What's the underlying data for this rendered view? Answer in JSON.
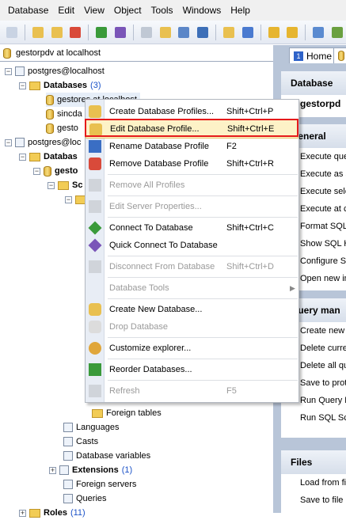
{
  "menubar": [
    "Database",
    "Edit",
    "View",
    "Object",
    "Tools",
    "Windows",
    "Help"
  ],
  "toolbar_icons": [
    "new-icon",
    "db-add-icon",
    "db-edit-icon",
    "db-remove-icon",
    "connect-icon",
    "quick-connect-icon",
    "disconnect-icon",
    "db-icon",
    "grid-icon",
    "options-icon",
    "db2-icon",
    "chart-icon",
    "sql-icon",
    "sql2-icon",
    "export-icon",
    "import-icon"
  ],
  "tree_header": "gestorpdv at localhost",
  "tree": [
    {
      "text": "postgres@localhost",
      "bold": false
    },
    {
      "text": "Databases",
      "count": "(3)",
      "bold": true
    },
    {
      "text": "gestores at localhost",
      "bold": false
    },
    {
      "text": "sincda",
      "bold": false
    },
    {
      "text": "gesto",
      "bold": false
    },
    {
      "text": "postgres@loc",
      "bold": false
    },
    {
      "text": "Databas",
      "bold": true
    },
    {
      "text": "gesto",
      "bold": true
    },
    {
      "text": "Sc",
      "bold": true
    },
    {
      "text": "Foreign tables",
      "bold": false
    },
    {
      "text": "Languages",
      "bold": false
    },
    {
      "text": "Casts",
      "bold": false
    },
    {
      "text": "Database variables",
      "bold": false
    },
    {
      "text": "Extensions",
      "count": "(1)",
      "bold": true
    },
    {
      "text": "Foreign servers",
      "bold": false
    },
    {
      "text": "Queries",
      "bold": false
    },
    {
      "text": "Roles",
      "count": "(11)",
      "bold": true
    }
  ],
  "tabs": {
    "home_num": "1",
    "home_label": "Home"
  },
  "right_panels": {
    "database_title": "Database",
    "database_value": "gestorpd",
    "general_title": "General",
    "general_items": [
      "Execute que",
      "Execute as s",
      "Execute sele",
      "Execute at c",
      "Format SQL",
      "Show SQL H",
      "Configure S",
      "Open new in"
    ],
    "query_title": "Query man",
    "query_items": [
      "Create new",
      "Delete curre",
      "Delete all qu",
      "Save to prot",
      "Run Query E",
      "Run SQL Scr"
    ],
    "files_title": "Files",
    "files_items": [
      "Load from fi",
      "Save to file"
    ]
  },
  "context_menu": [
    {
      "label": "Create Database Profiles...",
      "shortcut": "Shift+Ctrl+P",
      "disabled": false,
      "icon": "create-profile-icon"
    },
    {
      "label": "Edit Database Profile...",
      "shortcut": "Shift+Ctrl+E",
      "disabled": false,
      "icon": "edit-profile-icon",
      "highlight": true
    },
    {
      "label": "Rename Database Profile",
      "shortcut": "F2",
      "disabled": false,
      "icon": "rename-icon"
    },
    {
      "label": "Remove Database Profile",
      "shortcut": "Shift+Ctrl+R",
      "disabled": false,
      "icon": "remove-profile-icon"
    },
    {
      "label": "Remove All Profiles",
      "shortcut": "",
      "disabled": true,
      "icon": "remove-all-icon"
    },
    {
      "label": "Edit Server Properties...",
      "shortcut": "",
      "disabled": true,
      "icon": "server-properties-icon"
    },
    {
      "label": "Connect To Database",
      "shortcut": "Shift+Ctrl+C",
      "disabled": false,
      "icon": "connect-icon"
    },
    {
      "label": "Quick Connect To Database",
      "shortcut": "",
      "disabled": false,
      "icon": "quick-connect-icon"
    },
    {
      "label": "Disconnect From Database",
      "shortcut": "Shift+Ctrl+D",
      "disabled": true,
      "icon": "disconnect-icon"
    },
    {
      "label": "Database Tools",
      "shortcut": "",
      "disabled": true,
      "icon": "",
      "submenu": true
    },
    {
      "label": "Create New Database...",
      "shortcut": "",
      "disabled": false,
      "icon": "create-db-icon"
    },
    {
      "label": "Drop Database",
      "shortcut": "",
      "disabled": true,
      "icon": "drop-db-icon"
    },
    {
      "label": "Customize explorer...",
      "shortcut": "",
      "disabled": false,
      "icon": "customize-icon"
    },
    {
      "label": "Reorder Databases...",
      "shortcut": "",
      "disabled": false,
      "icon": "reorder-icon"
    },
    {
      "label": "Refresh",
      "shortcut": "F5",
      "disabled": true,
      "icon": "refresh-icon"
    }
  ]
}
